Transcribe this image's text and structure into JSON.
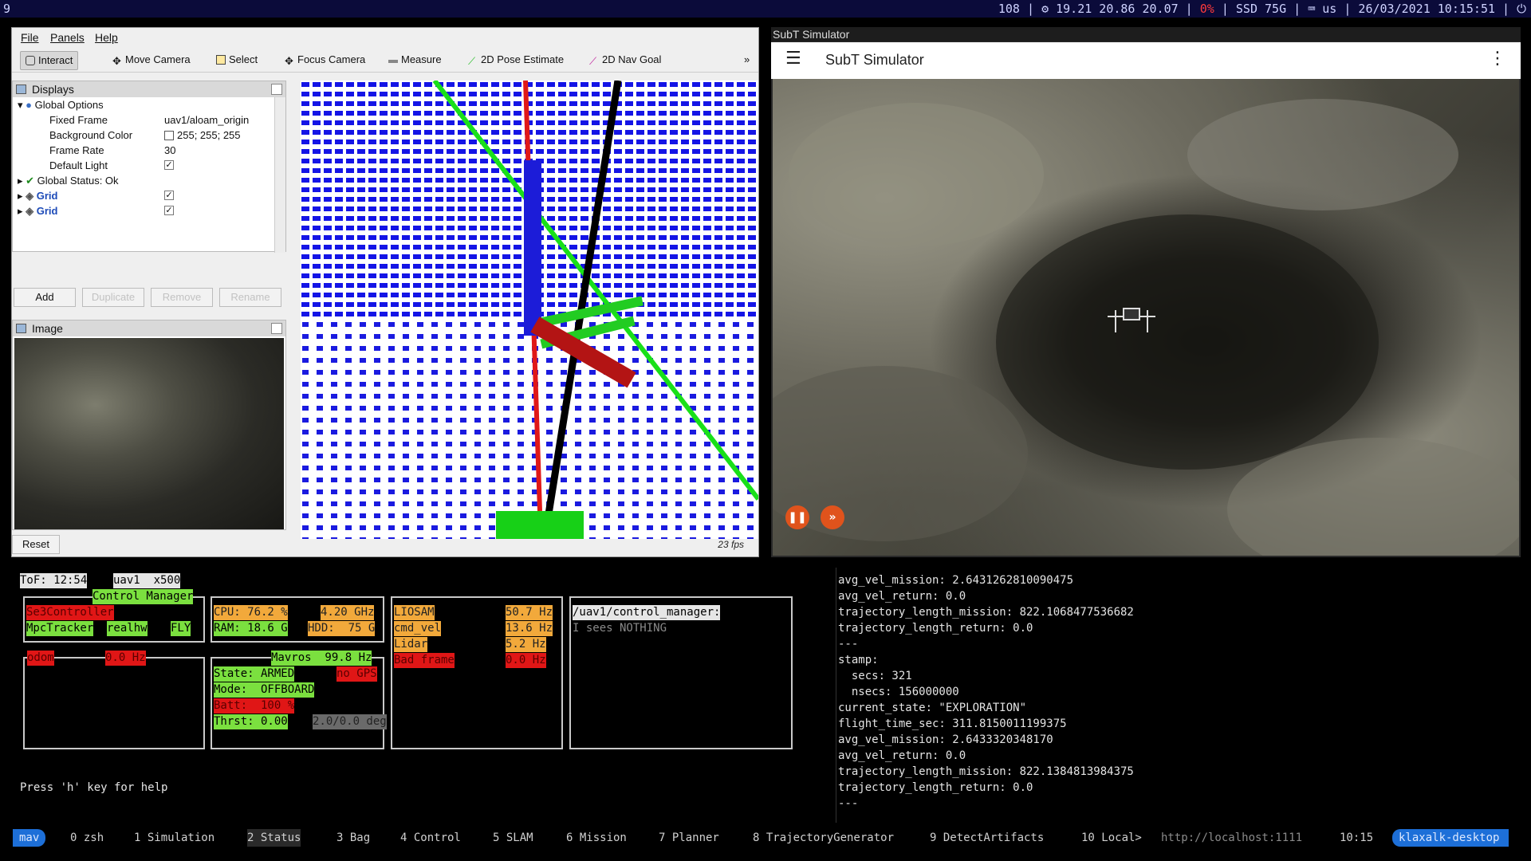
{
  "topbar": {
    "workspace": "9",
    "status_left": "108 | ",
    "load": "19.21 20.86 20.07",
    "sep1": " | ",
    "red_field": "0%",
    "disk": " | SSD 75G | ",
    "kbd": "us",
    "datetime": " | 26/03/2021 10:15:51 |"
  },
  "rviz": {
    "menu": [
      "File",
      "Panels",
      "Help"
    ],
    "tools": [
      {
        "label": "Interact",
        "icon": "hand-icon"
      },
      {
        "label": "Move Camera",
        "icon": "move-icon"
      },
      {
        "label": "Select",
        "icon": "select-icon"
      },
      {
        "label": "Focus Camera",
        "icon": "focus-icon"
      },
      {
        "label": "Measure",
        "icon": "ruler-icon"
      },
      {
        "label": "2D Pose Estimate",
        "icon": "pose-arrow-icon"
      },
      {
        "label": "2D Nav Goal",
        "icon": "nav-arrow-icon"
      }
    ],
    "displays_title": "Displays",
    "tree": {
      "global_options": "Global Options",
      "fixed_frame_label": "Fixed Frame",
      "fixed_frame_value": "uav1/aloam_origin",
      "bg_color_label": "Background Color",
      "bg_color_value": "255; 255; 255",
      "frame_rate_label": "Frame Rate",
      "frame_rate_value": "30",
      "default_light_label": "Default Light",
      "global_status": "Global Status: Ok",
      "grid1": "Grid",
      "grid2": "Grid"
    },
    "buttons": {
      "add": "Add",
      "duplicate": "Duplicate",
      "remove": "Remove",
      "rename": "Rename"
    },
    "image_title": "Image",
    "reset": "Reset",
    "fps": "23 fps"
  },
  "sim": {
    "window_title": "SubT Simulator",
    "bar_title": "SubT Simulator"
  },
  "term": {
    "tof": "ToF: 12:54",
    "uav": "uav1  x500",
    "control_manager": "Control Manager",
    "controller": "Se3Controller",
    "tracker": "MpcTracker",
    "realhw": "realhw",
    "fly": "FLY",
    "odom_bar1": "odom",
    "odom_bar2": "0.0 Hz",
    "cpu": "CPU: 76.2 %",
    "ghz": "4.20 GHz",
    "ram": "RAM: 18.6 G",
    "hdd": "HDD:  75 G",
    "mavros": "Mavros  99.8 Hz",
    "state": "State: ARMED",
    "mode": "Mode:  OFFBOARD",
    "batt": "Batt:  100 %",
    "thrst": "Thrst: 0.00",
    "tilt": "2.0/0.0 deg",
    "no_gps": "no GPS",
    "loam": "LIOSAM",
    "cmd_vel": "cmd_vel",
    "lidar": "Lidar",
    "rate1": "50.7 Hz",
    "rate2": "13.6 Hz",
    "rate3": "5.2 Hz",
    "bad_frame": "Bad frame",
    "rate4": "0.0 Hz",
    "topic": "/uav1/control_manager:",
    "topic_sub": "I sees NOTHING",
    "help": "Press 'h' key for help",
    "log": [
      "avg_vel_mission: 2.6431262810090475",
      "avg_vel_return: 0.0",
      "trajectory_length_mission: 822.1068477536682",
      "trajectory_length_return: 0.0",
      "---",
      "stamp:",
      "  secs: 321",
      "  nsecs: 156000000",
      "current_state: \"EXPLORATION\"",
      "flight_time_sec: 311.8150011199375",
      "avg_vel_mission: 2.6433320348170",
      "avg_vel_return: 0.0",
      "trajectory_length_mission: 822.1384813984375",
      "trajectory_length_return: 0.0",
      "---"
    ]
  },
  "tmux": {
    "session": "mav",
    "windows": [
      "0 zsh",
      "1 Simulation",
      "2 Status",
      "3 Bag",
      "4 Control",
      "5 SLAM",
      "6 Mission",
      "7 Planner",
      "8 TrajectoryGenerator",
      "9 DetectArtifacts",
      "10 Local>"
    ],
    "url": "http://localhost:1111",
    "time": "10:15",
    "host": "klaxalk-desktop"
  },
  "colors": {
    "accent_blue": "#1d6fd8",
    "status_green": "#7be03f",
    "status_red": "#e01616",
    "status_orange": "#f2a93b"
  }
}
